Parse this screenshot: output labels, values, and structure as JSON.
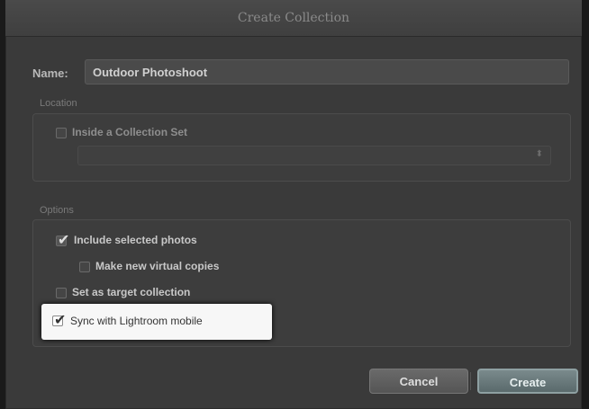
{
  "window": {
    "title": "Create Collection"
  },
  "name": {
    "label": "Name:",
    "value": "Outdoor Photoshoot"
  },
  "location": {
    "group_label": "Location",
    "inside_collection_set": {
      "label": "Inside a Collection Set",
      "checked": false
    },
    "collection_set_select": {
      "value": ""
    }
  },
  "options": {
    "group_label": "Options",
    "include_selected_photos": {
      "label": "Include selected photos",
      "checked": true
    },
    "make_new_virtual_copies": {
      "label": "Make new virtual copies",
      "checked": false
    },
    "set_as_target_collection": {
      "label": "Set as target collection",
      "checked": false
    },
    "sync_with_lightroom_mobile": {
      "label": "Sync with Lightroom mobile",
      "checked": true
    }
  },
  "buttons": {
    "cancel_label": "Cancel",
    "create_label": "Create"
  }
}
